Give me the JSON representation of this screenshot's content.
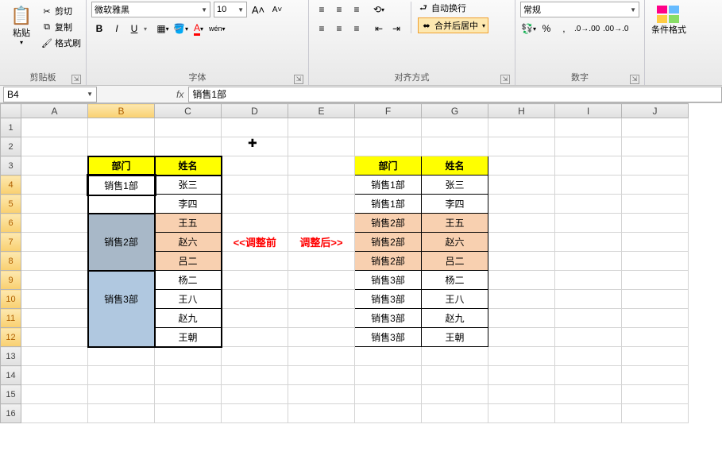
{
  "ribbon": {
    "clipboard": {
      "label": "剪贴板",
      "paste": "粘贴",
      "cut": "剪切",
      "copy": "复制",
      "format_painter": "格式刷"
    },
    "font": {
      "label": "字体",
      "name": "微软雅黑",
      "size": "10",
      "bold": "B",
      "italic": "I",
      "underline": "U",
      "wen": "wén"
    },
    "alignment": {
      "label": "对齐方式",
      "wrap": "自动换行",
      "merge": "合并后居中"
    },
    "number": {
      "label": "数字",
      "format": "常规"
    },
    "styles": {
      "conditional": "条件格式"
    }
  },
  "formula_bar": {
    "cell_ref": "B4",
    "fx": "fx",
    "formula": "销售1部"
  },
  "columns": [
    "A",
    "B",
    "C",
    "D",
    "E",
    "F",
    "G",
    "H",
    "I",
    "J"
  ],
  "rows": [
    "1",
    "2",
    "3",
    "4",
    "5",
    "6",
    "7",
    "8",
    "9",
    "10",
    "11",
    "12",
    "13",
    "14",
    "15",
    "16"
  ],
  "table_left": {
    "headers": [
      "部门",
      "姓名"
    ],
    "groups": [
      {
        "dept": "销售1部",
        "cls": "",
        "names": [
          "张三",
          "李四"
        ]
      },
      {
        "dept": "销售2部",
        "cls": "m2",
        "names": [
          "王五",
          "赵六",
          "吕二"
        ]
      },
      {
        "dept": "销售3部",
        "cls": "m3",
        "names": [
          "杨二",
          "王八",
          "赵九",
          "王朝"
        ]
      }
    ]
  },
  "table_right": {
    "headers": [
      "部门",
      "姓名"
    ],
    "rows": [
      {
        "dept": "销售1部",
        "name": "张三",
        "cls": ""
      },
      {
        "dept": "销售1部",
        "name": "李四",
        "cls": ""
      },
      {
        "dept": "销售2部",
        "name": "王五",
        "cls": "p"
      },
      {
        "dept": "销售2部",
        "name": "赵六",
        "cls": "p"
      },
      {
        "dept": "销售2部",
        "name": "吕二",
        "cls": "p"
      },
      {
        "dept": "销售3部",
        "name": "杨二",
        "cls": ""
      },
      {
        "dept": "销售3部",
        "name": "王八",
        "cls": ""
      },
      {
        "dept": "销售3部",
        "name": "赵九",
        "cls": ""
      },
      {
        "dept": "销售3部",
        "name": "王朝",
        "cls": ""
      }
    ]
  },
  "annotation": {
    "before": "<<调整前",
    "after": "调整后>>"
  }
}
